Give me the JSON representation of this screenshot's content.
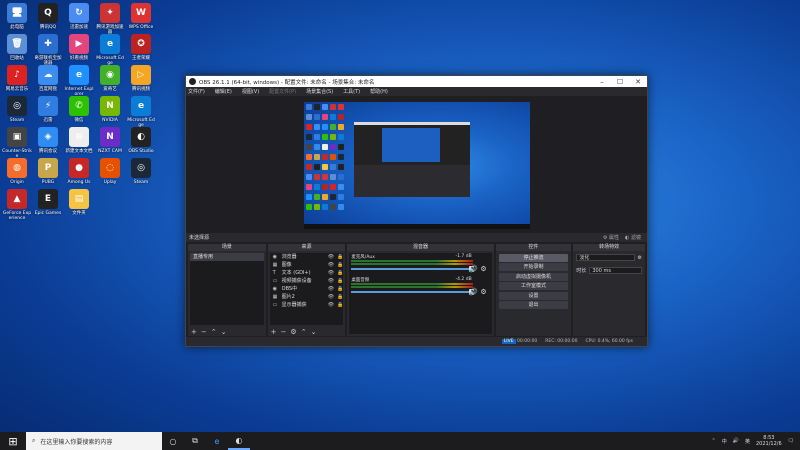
{
  "desktop_icons": [
    {
      "label": "此电脑",
      "glyph": "🖥",
      "color": "#3a7bd5"
    },
    {
      "label": "腾讯QQ",
      "glyph": "Q",
      "color": "#222"
    },
    {
      "label": "迅雷加速",
      "glyph": "↻",
      "color": "#4a8cf0"
    },
    {
      "label": "腾讯游戏加速器",
      "glyph": "✦",
      "color": "#c33"
    },
    {
      "label": "WPS Office",
      "glyph": "W",
      "color": "#d33"
    },
    {
      "label": "回收站",
      "glyph": "🗑",
      "color": "#5c8fd6"
    },
    {
      "label": "奇游联机宝加速器",
      "glyph": "✚",
      "color": "#2a6fcf"
    },
    {
      "label": "好看视频",
      "glyph": "▶",
      "color": "#e4457c"
    },
    {
      "label": "Microsoft Edge",
      "glyph": "e",
      "color": "#0c7dd6"
    },
    {
      "label": "王者荣耀",
      "glyph": "✪",
      "color": "#b22"
    },
    {
      "label": "网易云音乐",
      "glyph": "♪",
      "color": "#d22"
    },
    {
      "label": "百度网盘",
      "glyph": "☁",
      "color": "#3c8df0"
    },
    {
      "label": "Internet Explorer",
      "glyph": "e",
      "color": "#1e90ff"
    },
    {
      "label": "爱奇艺",
      "glyph": "◉",
      "color": "#43b02a"
    },
    {
      "label": "腾讯视频",
      "glyph": "▷",
      "color": "#f5a623"
    },
    {
      "label": "Steam",
      "glyph": "◎",
      "color": "#1b2838"
    },
    {
      "label": "迅雷",
      "glyph": "⚡",
      "color": "#2f7de1"
    },
    {
      "label": "微信",
      "glyph": "✆",
      "color": "#2dc100"
    },
    {
      "label": "NVIDIA",
      "glyph": "N",
      "color": "#76b900"
    },
    {
      "label": "Microsoft Edge",
      "glyph": "e",
      "color": "#0c7dd6"
    },
    {
      "label": "Counter-Strike",
      "glyph": "▣",
      "color": "#444"
    },
    {
      "label": "腾讯会议",
      "glyph": "◈",
      "color": "#2f8cf0"
    },
    {
      "label": "新建文本文档",
      "glyph": "≡",
      "color": "#eee"
    },
    {
      "label": "NZXT CAM",
      "glyph": "N",
      "color": "#6b2cc7"
    },
    {
      "label": "OBS Studio",
      "glyph": "◐",
      "color": "#222"
    },
    {
      "label": "Origin",
      "glyph": "◍",
      "color": "#f56c2d"
    },
    {
      "label": "PUBG",
      "glyph": "P",
      "color": "#c8a64b"
    },
    {
      "label": "Among Us",
      "glyph": "●",
      "color": "#c62828"
    },
    {
      "label": "Uplay",
      "glyph": "◌",
      "color": "#e65100"
    },
    {
      "label": "Steam",
      "glyph": "◎",
      "color": "#1b2838"
    },
    {
      "label": "GeForce Experience",
      "glyph": "▲",
      "color": "#c62828"
    },
    {
      "label": "Epic Games",
      "glyph": "E",
      "color": "#222"
    },
    {
      "label": "文件夹",
      "glyph": "▤",
      "color": "#f6c343"
    }
  ],
  "obs": {
    "title": "OBS 26.1.1 (64-bit, windows) - 配置文件: 未命名 - 场景集合: 未命名",
    "menu": [
      "文件(F)",
      "编辑(E)",
      "视图(V)",
      "配置文件(P)",
      "场景集合(S)",
      "工具(T)",
      "帮助(H)"
    ],
    "scene_bar": {
      "label": "未选择源",
      "properties": "属性",
      "filters": "滤镜"
    },
    "docks": {
      "scenes": {
        "title": "场景",
        "items": [
          "直播专用"
        ]
      },
      "sources": {
        "title": "来源",
        "items": [
          {
            "icon": "◉",
            "name": "浏览器"
          },
          {
            "icon": "▦",
            "name": "图像"
          },
          {
            "icon": "T",
            "name": "文本 (GDI+)"
          },
          {
            "icon": "▭",
            "name": "视频捕获设备"
          },
          {
            "icon": "◉",
            "name": "OBS中"
          },
          {
            "icon": "▦",
            "name": "图片2"
          },
          {
            "icon": "▭",
            "name": "显示器捕获"
          }
        ]
      },
      "mixer": {
        "title": "混音器",
        "channels": [
          {
            "name": "麦克风/Aux",
            "db": "-1.7 dB"
          },
          {
            "name": "桌面音频",
            "db": "-4.2 dB"
          }
        ]
      },
      "controls": {
        "title": "控件",
        "buttons": [
          "停止推流",
          "开始录制",
          "启动虚拟摄像机",
          "工作室模式",
          "设置",
          "退出"
        ]
      },
      "transitions": {
        "title": "转场特效",
        "type": "淡化",
        "duration_label": "时长",
        "duration": "300 ms"
      }
    },
    "status": {
      "live": "LIVE",
      "live_time": "00:00:00",
      "rec": "REC: 00:00:00",
      "cpu": "CPU: 0.4%, 60.00 fps"
    }
  },
  "taskbar": {
    "search_placeholder": "在这里输入你要搜索的内容",
    "time": "8:53",
    "date": "2021/12/6",
    "ime": "中",
    "tray": "英"
  }
}
